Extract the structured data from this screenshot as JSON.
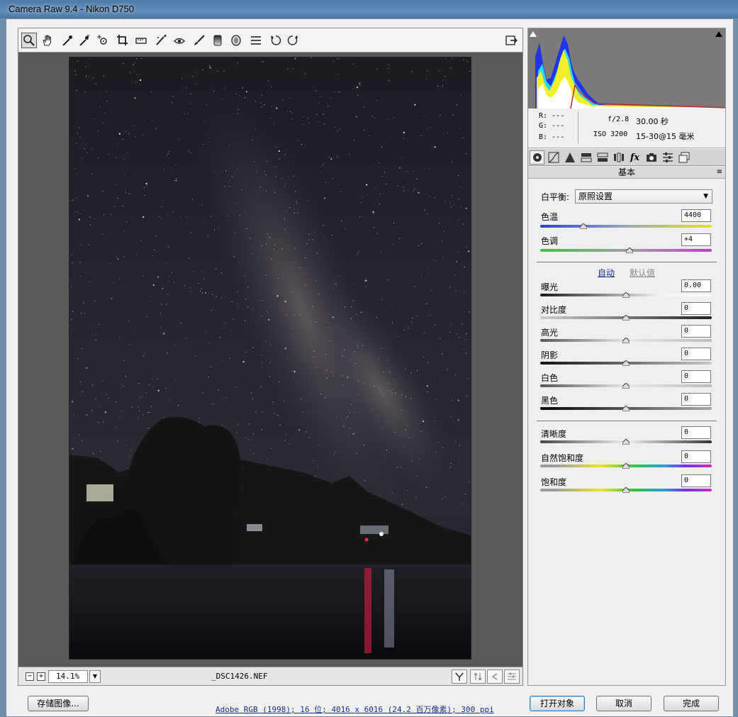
{
  "window": {
    "title": "Camera Raw 9.4 -  Nikon D750"
  },
  "toolbar": {
    "tools": [
      "zoom-tool",
      "hand-tool",
      "white-balance-tool",
      "color-sampler-tool",
      "targeted-adjustment-tool",
      "crop-tool",
      "straighten-tool",
      "spot-removal-tool",
      "red-eye-tool",
      "adjustment-brush",
      "graduated-filter",
      "radial-filter",
      "preferences",
      "rotate-ccw",
      "rotate-cw"
    ],
    "fullscreen": "open-fullscreen-icon"
  },
  "image": {
    "filename": "_DSC1426.NEF",
    "zoom": "14.1%",
    "zoom_out": "−",
    "zoom_in": "+",
    "zoom_dropdown": "▼"
  },
  "statusbar": {
    "icons": [
      "y-compare-icon",
      "swap-icon",
      "copy-settings-icon",
      "toggle-settings-icon"
    ]
  },
  "histogram": {
    "colors": {
      "red": "#d0212a",
      "yellow": "#f2ef2a",
      "blue": "#2235e6",
      "cyan": "#2ad9ee",
      "white": "#ffffff"
    }
  },
  "info": {
    "r": "R:  ---",
    "g": "G:  ---",
    "b": "B:  ---",
    "aperture": "f/2.8",
    "shutter": "30.00 秒",
    "iso": "ISO 3200",
    "lens": "15-30@15 毫米"
  },
  "panel_tabs": [
    "basic-icon",
    "tone-curve-icon",
    "detail-icon",
    "hsl-icon",
    "split-toning-icon",
    "lens-corrections-icon",
    "effects-icon",
    "camera-calibration-icon",
    "presets-icon",
    "snapshots-icon"
  ],
  "panel": {
    "title": "基本",
    "menu": "≡",
    "white_balance": {
      "label": "白平衡:",
      "value": "原照设置",
      "arrow": "▼"
    },
    "temperature": {
      "label": "色温",
      "value": "4400",
      "level": 0.25
    },
    "tint": {
      "label": "色调",
      "value": "+4",
      "level": 0.52
    },
    "auto": "自动",
    "default": "默认值",
    "sliders": [
      {
        "label": "曝光",
        "value": "0.00",
        "level": 0.5
      },
      {
        "label": "对比度",
        "value": "0",
        "level": 0.5
      },
      {
        "label": "高光",
        "value": "0",
        "level": 0.5
      },
      {
        "label": "阴影",
        "value": "0",
        "level": 0.5
      },
      {
        "label": "白色",
        "value": "0",
        "level": 0.5
      },
      {
        "label": "黑色",
        "value": "0",
        "level": 0.5
      }
    ],
    "presence": [
      {
        "label": "清晰度",
        "value": "0",
        "level": 0.5
      },
      {
        "label": "自然饱和度",
        "value": "0",
        "level": 0.5
      },
      {
        "label": "饱和度",
        "value": "0",
        "level": 0.5
      }
    ]
  },
  "footer": {
    "save": "存储图像...",
    "workflow": "Adobe RGB (1998); 16 位; 4016 x 6016 (24.2 百万像素); 300 ppi",
    "open": "打开对象",
    "cancel": "取消",
    "done": "完成"
  }
}
